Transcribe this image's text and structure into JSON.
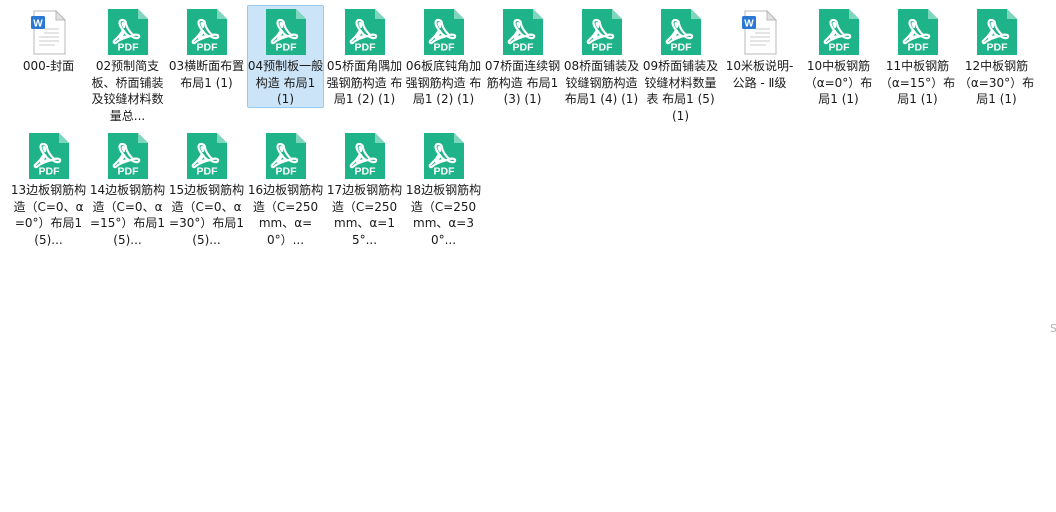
{
  "window": {
    "edge_text": "Sort"
  },
  "colors": {
    "pdf_green": "#1fb38a",
    "word_blue": "#2b78d4",
    "selection_bg": "#cce4f7",
    "selection_border": "#99c9ef"
  },
  "files": [
    {
      "name": "000-封面",
      "type": "word",
      "icon": "word-doc-icon"
    },
    {
      "name": "02预制简支板、桥面铺装及铰缝材料数量总...",
      "type": "pdf",
      "icon": "pdf-icon"
    },
    {
      "name": "03横断面布置 布局1 (1)",
      "type": "pdf",
      "icon": "pdf-icon"
    },
    {
      "name": "04预制板一般构造 布局1 (1)",
      "type": "pdf",
      "icon": "pdf-icon",
      "selected": true
    },
    {
      "name": "05桥面角隅加强钢筋构造 布局1 (2) (1)",
      "type": "pdf",
      "icon": "pdf-icon"
    },
    {
      "name": "06板底钝角加强钢筋构造 布局1 (2) (1)",
      "type": "pdf",
      "icon": "pdf-icon"
    },
    {
      "name": "07桥面连续钢筋构造 布局1 (3) (1)",
      "type": "pdf",
      "icon": "pdf-icon"
    },
    {
      "name": "08桥面铺装及铰缝钢筋构造 布局1 (4) (1)",
      "type": "pdf",
      "icon": "pdf-icon"
    },
    {
      "name": "09桥面铺装及铰缝材料数量表 布局1 (5) (1)",
      "type": "pdf",
      "icon": "pdf-icon"
    },
    {
      "name": "10米板说明-公路 - Ⅱ级",
      "type": "word",
      "icon": "word-doc-icon"
    },
    {
      "name": "10中板钢筋（α=0°）布局1 (1)",
      "type": "pdf",
      "icon": "pdf-icon"
    },
    {
      "name": "11中板钢筋（α=15°）布局1 (1)",
      "type": "pdf",
      "icon": "pdf-icon"
    },
    {
      "name": "12中板钢筋（α=30°）布局1 (1)",
      "type": "pdf",
      "icon": "pdf-icon"
    },
    {
      "name": "13边板钢筋构造（C=0、α=0°）布局1 (5)...",
      "type": "pdf",
      "icon": "pdf-icon"
    },
    {
      "name": "14边板钢筋构造（C=0、α=15°）布局1 (5)...",
      "type": "pdf",
      "icon": "pdf-icon"
    },
    {
      "name": "15边板钢筋构造（C=0、α=30°）布局1 (5)...",
      "type": "pdf",
      "icon": "pdf-icon"
    },
    {
      "name": "16边板钢筋构造（C=250mm、α=0°）...",
      "type": "pdf",
      "icon": "pdf-icon"
    },
    {
      "name": "17边板钢筋构造（C=250mm、α=15°...",
      "type": "pdf",
      "icon": "pdf-icon"
    },
    {
      "name": "18边板钢筋构造（C=250mm、α=30°...",
      "type": "pdf",
      "icon": "pdf-icon"
    }
  ],
  "icon_text": {
    "pdf": "PDF",
    "word": "W"
  }
}
